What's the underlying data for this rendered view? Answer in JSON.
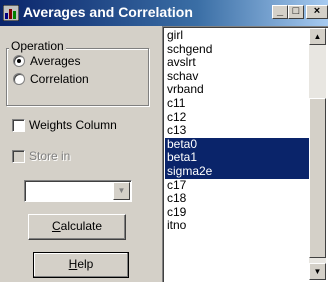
{
  "window": {
    "title": "Averages and Correlation",
    "icon": "chart-icon",
    "controls": {
      "minimize": "_",
      "maximize": "□",
      "close": "×"
    }
  },
  "operation": {
    "group_label": "Operation",
    "options": [
      "Averages",
      "Correlation"
    ],
    "selected": "Averages"
  },
  "weights_column": {
    "label": "Weights Column",
    "checked": false
  },
  "store_in": {
    "label": "Store in",
    "checked": false,
    "enabled": false
  },
  "store_target": {
    "value": ""
  },
  "buttons": {
    "calculate": "Calculate",
    "help": "Help"
  },
  "variable_list": {
    "items": [
      "girl",
      "schgend",
      "avslrt",
      "schav",
      "vrband",
      "c11",
      "c12",
      "c13",
      "beta0",
      "beta1",
      "sigma2e",
      "c17",
      "c18",
      "c19",
      "itno"
    ],
    "selected": [
      "beta0",
      "beta1",
      "sigma2e"
    ]
  },
  "colors": {
    "selection": "#0a246a",
    "face": "#d4d0c8",
    "title_start": "#0a246a"
  }
}
